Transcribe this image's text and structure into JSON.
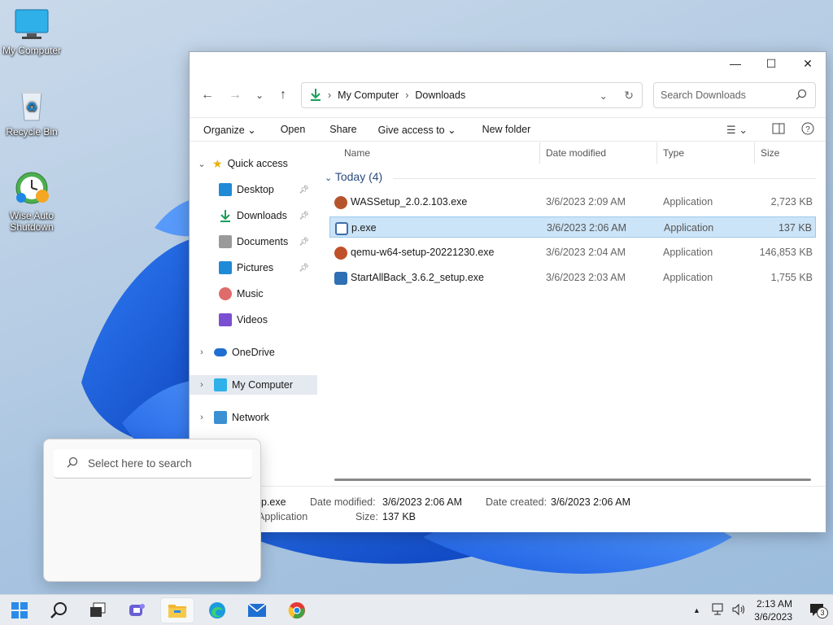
{
  "desktop": {
    "icons": [
      {
        "label": "My Computer",
        "icon": "monitor-icon"
      },
      {
        "label": "Recycle Bin",
        "icon": "recycle-bin-icon"
      },
      {
        "label": "Wise Auto Shutdown",
        "icon": "clock-shutdown-icon"
      }
    ]
  },
  "explorer": {
    "caption": {
      "minimize": "—",
      "maximize": "☐",
      "close": "✕"
    },
    "nav": {
      "back": "←",
      "forward": "→",
      "recent": "⌄",
      "up": "↑"
    },
    "breadcrumb": [
      "My Computer",
      "Downloads"
    ],
    "search_placeholder": "Search Downloads",
    "commands": [
      "Organize",
      "Open",
      "Share",
      "Give access to",
      "New folder"
    ],
    "navpane": {
      "quick_access": "Quick access",
      "quick_items": [
        {
          "label": "Desktop",
          "icon": "desktop-folder-icon",
          "color": "#1f8ad6",
          "pinned": true
        },
        {
          "label": "Downloads",
          "icon": "downloads-arrow-icon",
          "color": "#1b9e5a",
          "pinned": true
        },
        {
          "label": "Documents",
          "icon": "document-icon",
          "color": "#8c8c8c",
          "pinned": true
        },
        {
          "label": "Pictures",
          "icon": "pictures-icon",
          "color": "#1f8ad6",
          "pinned": true
        },
        {
          "label": "Music",
          "icon": "music-icon",
          "color": "#e06b6b",
          "pinned": false
        },
        {
          "label": "Videos",
          "icon": "videos-icon",
          "color": "#7a4fd1",
          "pinned": false
        }
      ],
      "onedrive": "OneDrive",
      "mycomputer": "My Computer",
      "network": "Network"
    },
    "columns": {
      "name": "Name",
      "date": "Date modified",
      "type": "Type",
      "size": "Size"
    },
    "group": "Today (4)",
    "files": [
      {
        "name": "WASSetup_2.0.2.103.exe",
        "date": "3/6/2023 2:09 AM",
        "type": "Application",
        "size": "2,723 KB",
        "icon": "app-installer-icon",
        "color": "#b5542c"
      },
      {
        "name": "p.exe",
        "date": "3/6/2023 2:06 AM",
        "type": "Application",
        "size": "137 KB",
        "icon": "exe-icon",
        "color": "#3d6fa8"
      },
      {
        "name": "qemu-w64-setup-20221230.exe",
        "date": "3/6/2023 2:04 AM",
        "type": "Application",
        "size": "146,853 KB",
        "icon": "qemu-icon",
        "color": "#c0502a"
      },
      {
        "name": "StartAllBack_3.6.2_setup.exe",
        "date": "3/6/2023 2:03 AM",
        "type": "Application",
        "size": "1,755 KB",
        "icon": "setup-icon",
        "color": "#2f6fb3"
      }
    ],
    "details": {
      "name": "p.exe",
      "type": "Application",
      "modified_label": "Date modified:",
      "modified": "3/6/2023 2:06 AM",
      "created_label": "Date created:",
      "created": "3/6/2023 2:06 AM",
      "size_label": "Size:",
      "size": "137 KB"
    }
  },
  "search_flyout": {
    "placeholder": "Select here to search"
  },
  "taskbar": {
    "time": "2:13 AM",
    "date": "3/6/2023",
    "notification_count": "3",
    "tray_arrow": "▲"
  }
}
